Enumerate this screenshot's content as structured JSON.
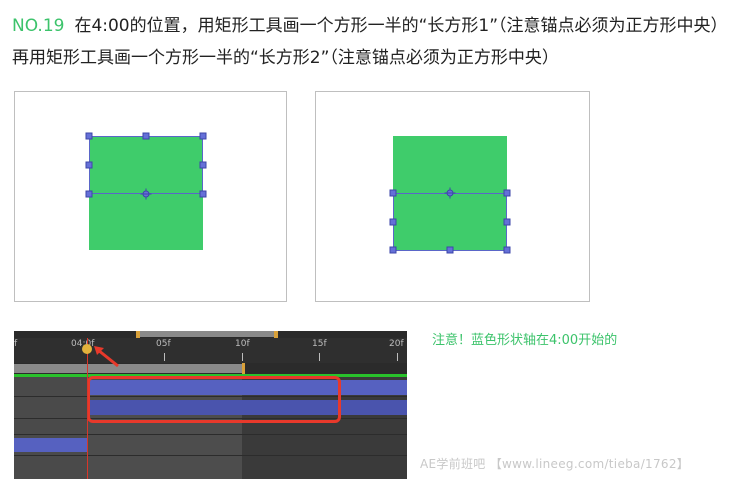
{
  "instruction": {
    "step": "NO.19",
    "text": "在4:00的位置，用矩形工具画一个方形一半的“长方形1”（注意锚点必须为正方形中央）再用矩形工具画一个方形一半的“长方形2”（注意锚点必须为正方形中央）"
  },
  "colors": {
    "accent_green": "#3cc36b",
    "shape_green": "#3fcc6b",
    "handle_blue": "#6570d8",
    "highlight_red": "#e8392b",
    "layer_blue": "#5661c0"
  },
  "timeline": {
    "ticks": [
      "f",
      "04:0f",
      "05f",
      "10f",
      "15f",
      "20f"
    ]
  },
  "note": "注意！蓝色形状轴在4:00开始的",
  "watermark": "AE学前班吧 【www.lineeg.com/tieba/1762】"
}
